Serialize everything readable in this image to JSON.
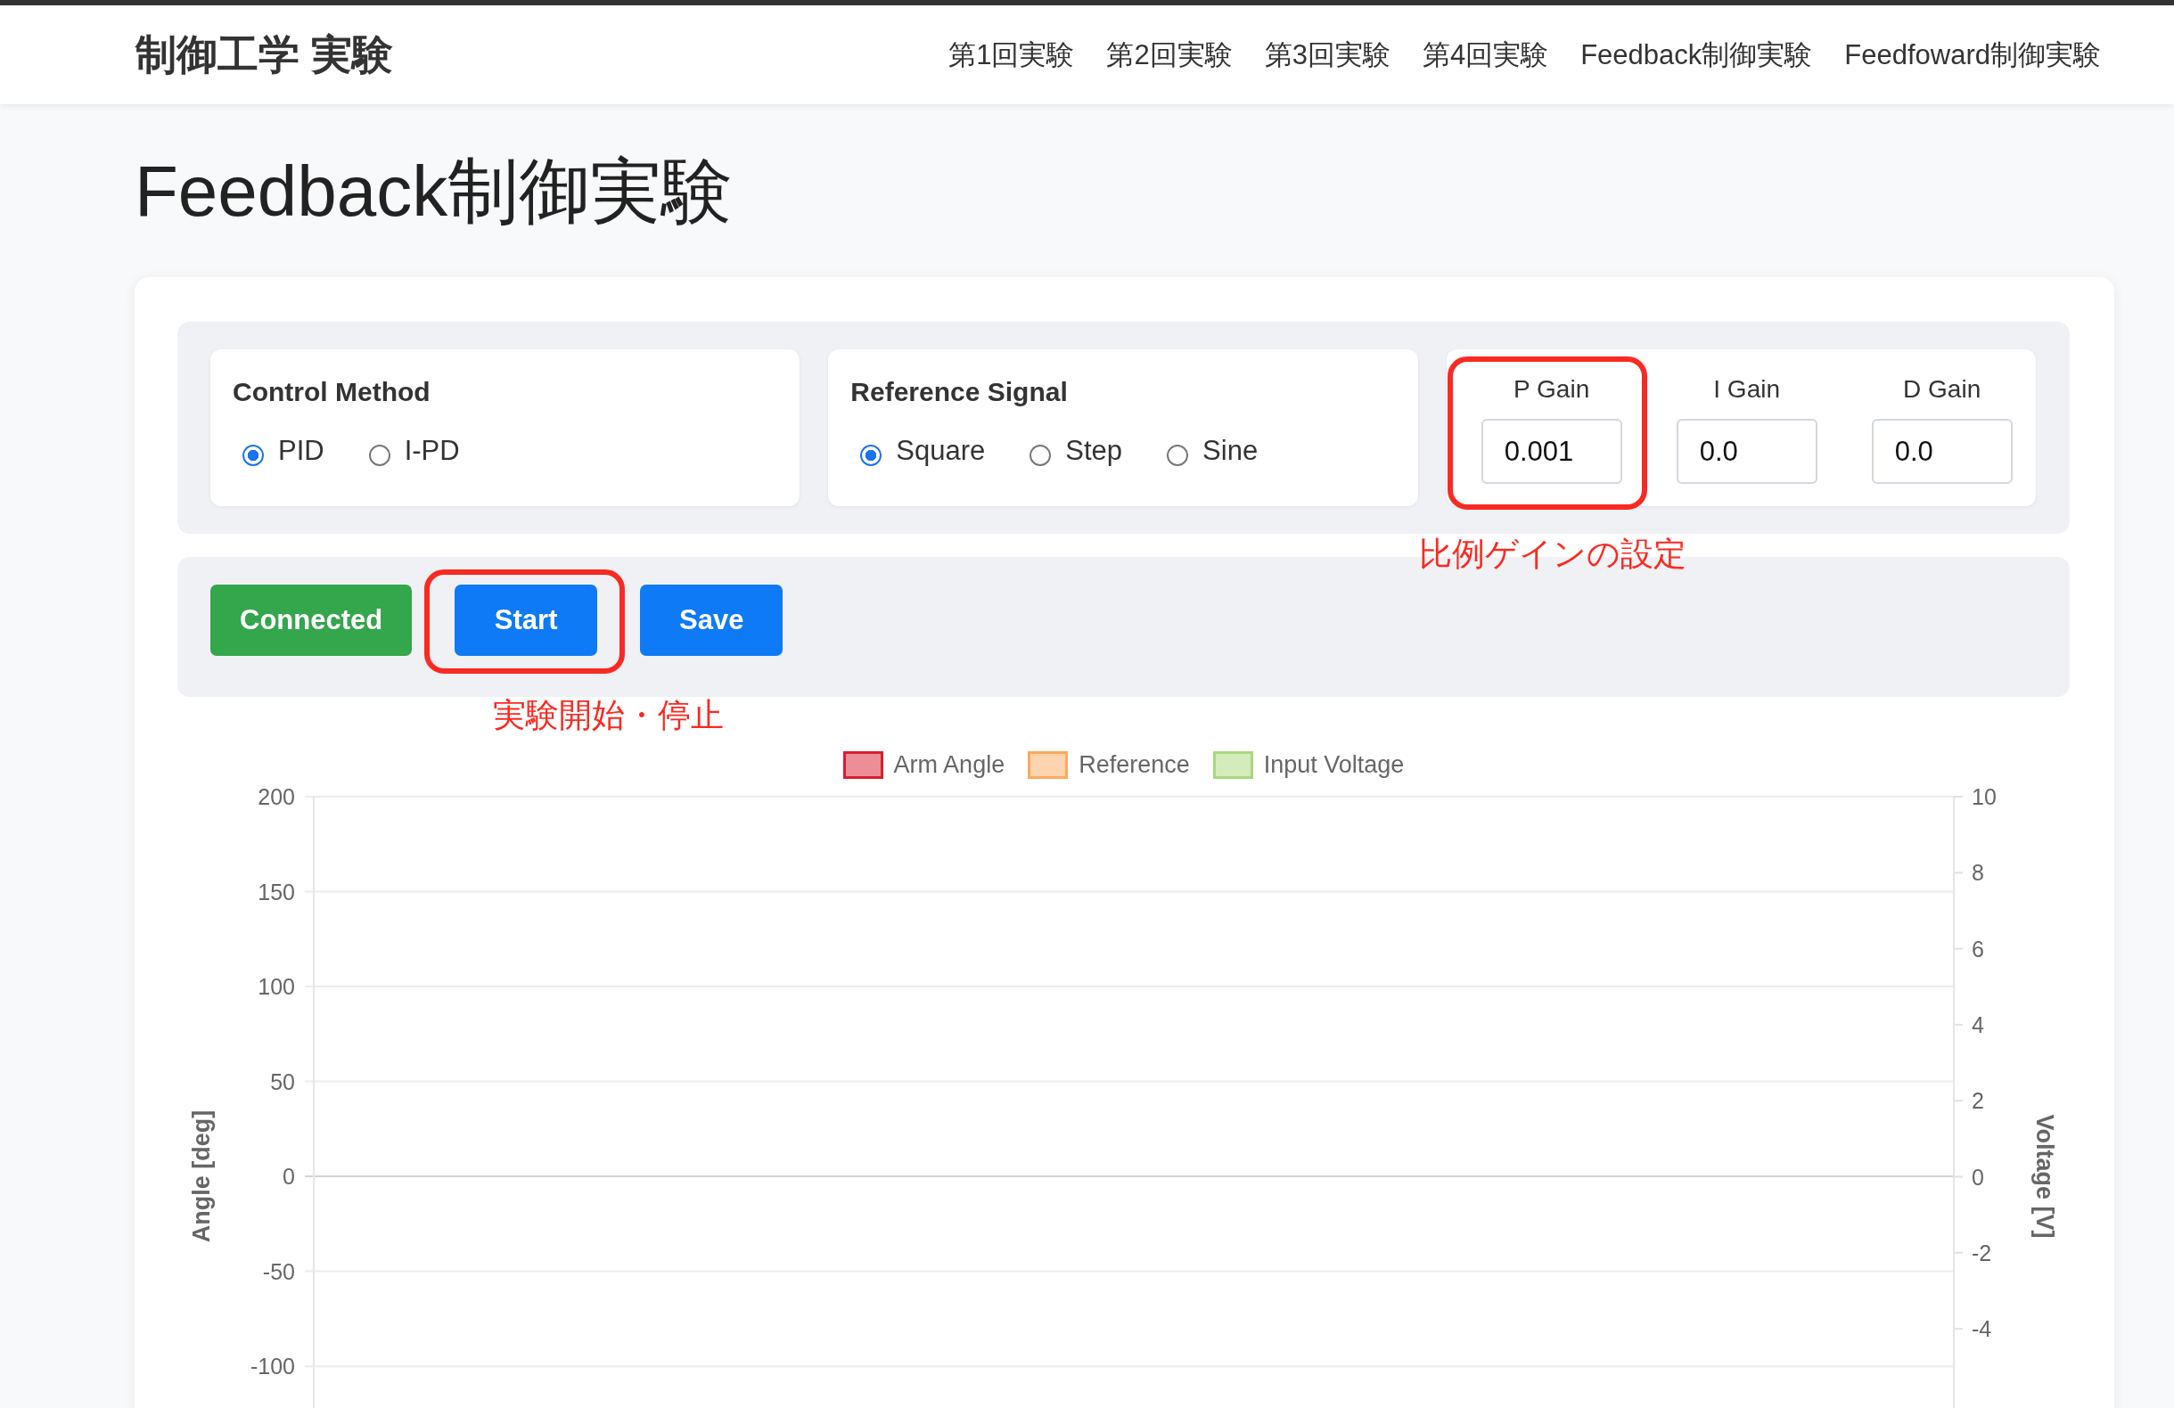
{
  "navbar": {
    "brand": "制御工学 実験",
    "links": [
      "第1回実験",
      "第2回実験",
      "第3回実験",
      "第4回実験",
      "Feedback制御実験",
      "Feedfoward制御実験"
    ]
  },
  "page_title": "Feedback制御実験",
  "settings": {
    "option_groups": [
      {
        "title": "Control Method",
        "options": [
          {
            "label": "PID",
            "selected": true
          },
          {
            "label": "I-PD",
            "selected": false
          }
        ]
      },
      {
        "title": "Reference Signal",
        "options": [
          {
            "label": "Square",
            "selected": true
          },
          {
            "label": "Step",
            "selected": false
          },
          {
            "label": "Sine",
            "selected": false
          }
        ]
      }
    ],
    "gains": [
      {
        "label": "P Gain",
        "value": "0.001",
        "annotation": "比例ゲインの設定"
      },
      {
        "label": "I Gain",
        "value": "0.0"
      },
      {
        "label": "D Gain",
        "value": "0.0"
      }
    ]
  },
  "actions": [
    {
      "label": "Connected",
      "kind": "success"
    },
    {
      "label": "Start",
      "kind": "primary",
      "annotation": "実験開始・停止"
    },
    {
      "label": "Save",
      "kind": "primary"
    }
  ],
  "chart": {
    "chart_data": {
      "type": "line",
      "ylabel": "Angle [deg]",
      "ylim": [
        -122,
        200
      ],
      "yticks": [
        200,
        150,
        100,
        50,
        0,
        -50,
        -100
      ],
      "grid": true,
      "series": [
        {
          "name": "Arm Angle",
          "color": "#d91e2f"
        },
        {
          "name": "Reference",
          "color": "#fca95c"
        },
        {
          "name": "Input Voltage",
          "color": "#a9d97b"
        }
      ]
    },
    "right_axis": {
      "label": "Voltage [V]",
      "ticks": [
        "10",
        "8",
        "6",
        "4",
        "2",
        "0",
        "-2",
        "-4"
      ]
    }
  }
}
